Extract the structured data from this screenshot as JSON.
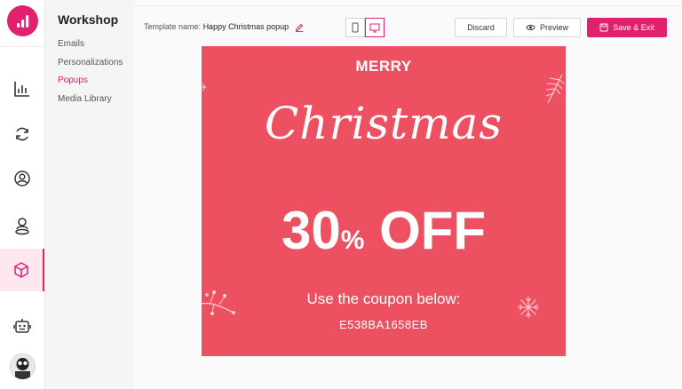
{
  "sidebar": {
    "title": "Workshop",
    "links": [
      "Emails",
      "Personalizations",
      "Popups",
      "Media Library"
    ],
    "active": "Popups"
  },
  "rail": {
    "icons": [
      "analytics-icon",
      "refresh-icon",
      "contacts-icon",
      "user-pin-icon",
      "cube-icon",
      "bot-icon"
    ],
    "active": "cube-icon"
  },
  "toolbar": {
    "template_label": "Template name:",
    "template_name": "Happy Christmas popup",
    "discard": "Discard",
    "preview": "Preview",
    "save_exit": "Save & Exit"
  },
  "popup": {
    "merry": "MERRY",
    "christmas": "Christmas",
    "discount_number": "30",
    "discount_percent": "%",
    "discount_off": "OFF",
    "coupon_label": "Use the coupon below:",
    "coupon_code": "E538BA1658EB"
  },
  "colors": {
    "accent": "#e2206e",
    "popup_bg": "#ed5060"
  }
}
